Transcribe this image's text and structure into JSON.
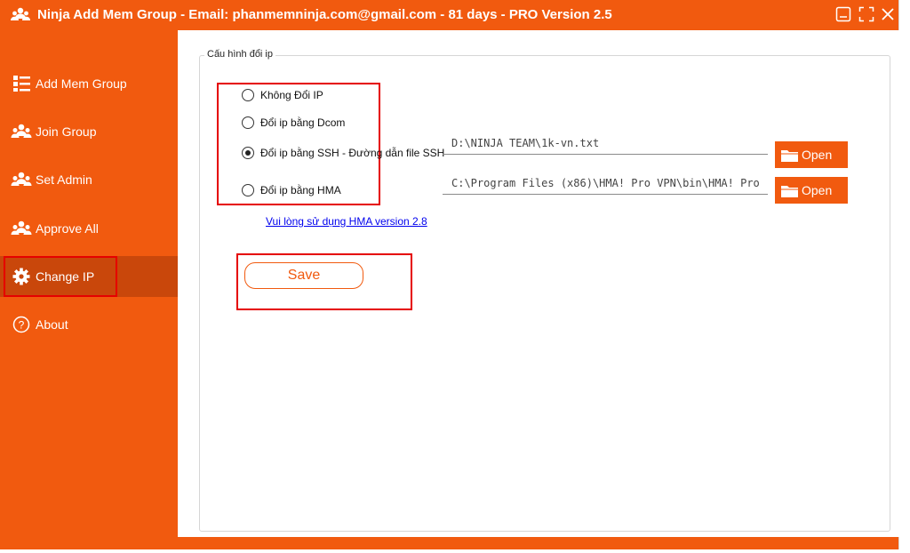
{
  "window": {
    "title": "Ninja Add Mem Group - Email: phanmemninja.com@gmail.com - 81 days - PRO Version 2.5",
    "accent_color": "#f15a0f",
    "highlight_color": "#e50000"
  },
  "sidebar": {
    "items": [
      {
        "label": "Add Mem Group",
        "icon": "list-icon"
      },
      {
        "label": "Join Group",
        "icon": "users-icon"
      },
      {
        "label": "Set Admin",
        "icon": "users-icon"
      },
      {
        "label": "Approve All",
        "icon": "users-icon"
      },
      {
        "label": "Change IP",
        "icon": "gear-icon",
        "active": true
      },
      {
        "label": "About",
        "icon": "help-icon"
      }
    ]
  },
  "main": {
    "group_title": "Cấu hình đổi ip",
    "radios": [
      {
        "label": "Không Đổi IP",
        "checked": false
      },
      {
        "label": "Đổi ip bằng Dcom",
        "checked": false
      },
      {
        "label": "Đổi ip bằng SSH - Đường dẫn file SSH",
        "checked": true
      },
      {
        "label": "Đổi ip bằng HMA",
        "checked": false
      }
    ],
    "ssh_path": "D:\\NINJA TEAM\\1k-vn.txt",
    "hma_path": "C:\\Program Files (x86)\\HMA! Pro VPN\\bin\\HMA! Pro",
    "open_label": "Open",
    "hma_link": "Vui lòng sử dụng HMA version 2.8",
    "save_label": "Save"
  }
}
